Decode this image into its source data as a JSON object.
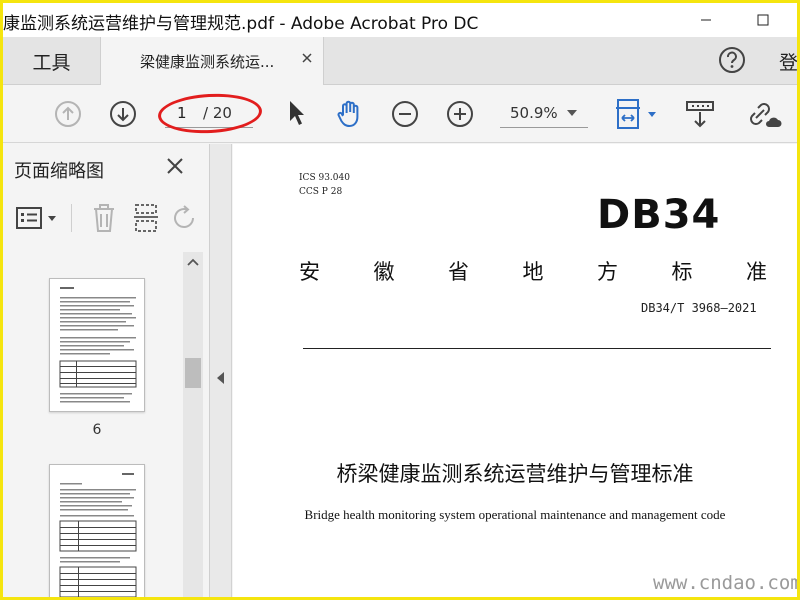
{
  "window": {
    "title": "康监测系统运营维护与管理规范.pdf - Adobe Acrobat Pro DC"
  },
  "tabs": {
    "tools_label": "工具",
    "document_label": "梁健康监测系统运...",
    "signin_label": "登"
  },
  "toolbar": {
    "current_page": "1",
    "page_total": "/ 20",
    "zoom_value": "50.9%",
    "accent_color": "#2d6fc7",
    "annotation_color": "#e21d1d"
  },
  "sidebar": {
    "title": "页面缩略图",
    "thumbnails": [
      {
        "label": "6"
      },
      {
        "label": ""
      }
    ]
  },
  "document": {
    "ics_line": "ICS  93.040",
    "ccs_line": "CCS  P 28",
    "db_mark": "DB34",
    "province_chars": [
      "安",
      "徽",
      "省",
      "地",
      "方",
      "标",
      "准"
    ],
    "standard_number": "DB34/T 3968—2021",
    "title_cn": "桥梁健康监测系统运营维护与管理标准",
    "title_en": "Bridge health monitoring system operational maintenance and management code"
  },
  "watermark": {
    "text": "www.cndao.com"
  }
}
